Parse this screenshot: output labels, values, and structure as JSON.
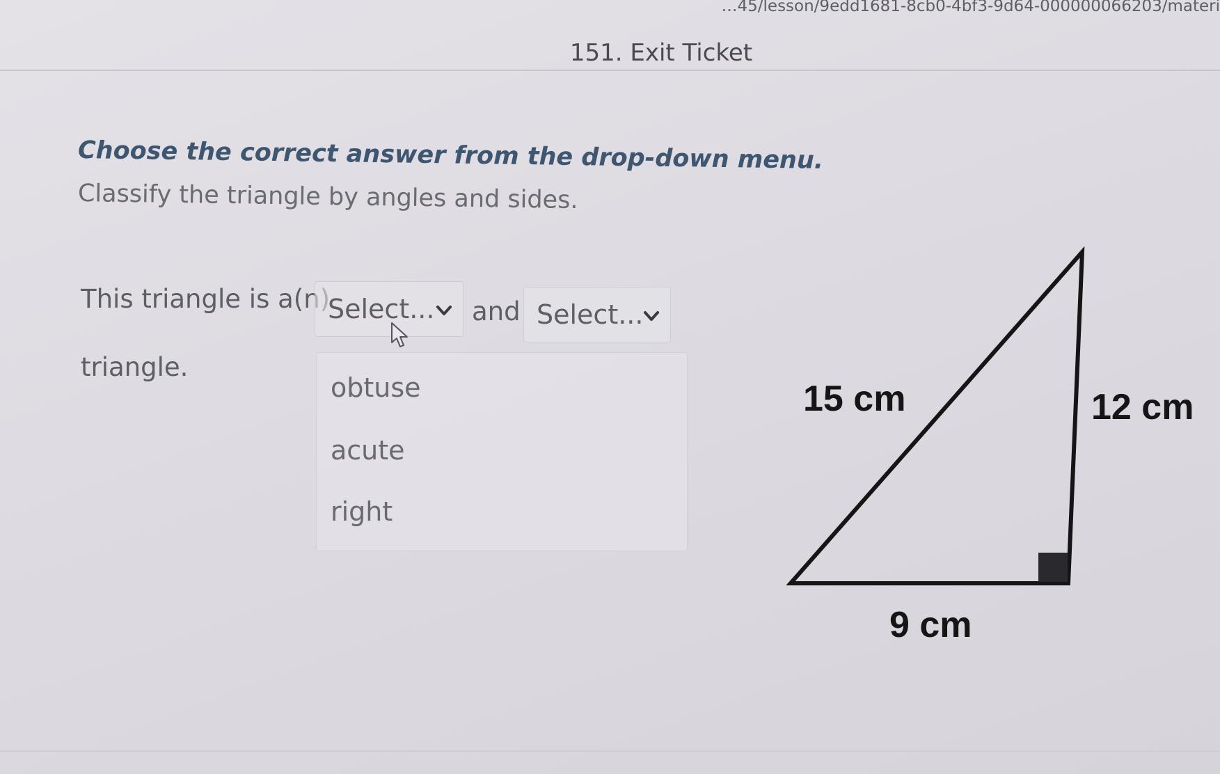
{
  "browser": {
    "url_fragment": "…45/lesson/9edd1681-8cb0-4bf3-9d64-000000066203/materi"
  },
  "page": {
    "title": "151. Exit Ticket"
  },
  "question": {
    "instruction": "Choose the correct answer from the drop-down menu.",
    "prompt": "Classify the triangle by angles and sides.",
    "sentence_start": "This triangle is a(n)",
    "sentence_middle": "and",
    "sentence_end": "triangle.",
    "select1": {
      "value": "Select...",
      "expanded": true,
      "options": [
        "obtuse",
        "acute",
        "right"
      ]
    },
    "select2": {
      "value": "Select...",
      "expanded": false
    }
  },
  "diagram": {
    "hypotenuse_label": "15 cm",
    "vertical_label": "12 cm",
    "base_label": "9 cm"
  },
  "icons": {
    "chevron": "chevron-down-icon",
    "cursor": "mouse-pointer-icon"
  },
  "colors": {
    "instruction": "#3e5670",
    "background": "#dddbe1",
    "diagram_stroke": "#151515"
  }
}
